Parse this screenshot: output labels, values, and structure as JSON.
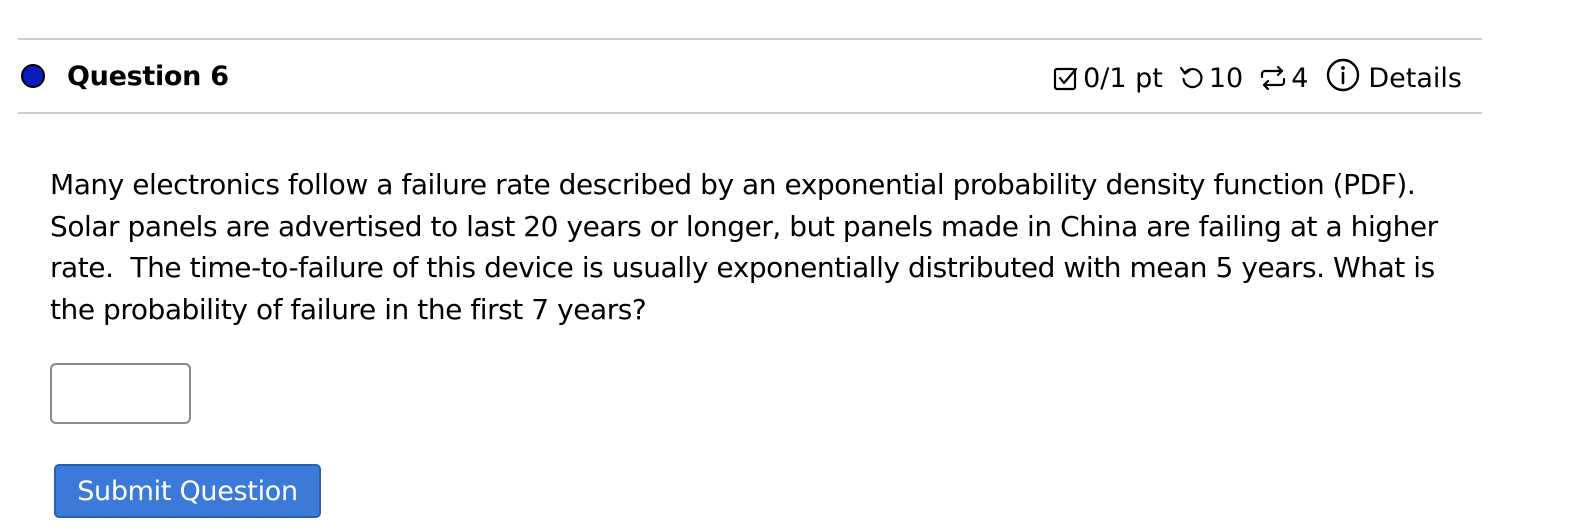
{
  "question": {
    "title": "Question 6",
    "status_color": "#0a1cbd",
    "score": "0/1 pt",
    "attempts": "10",
    "versions": "4",
    "details_label": "Details",
    "icons": {
      "score": "checkbox-icon",
      "attempts": "retry-icon",
      "versions": "swap-icon",
      "details": "info-icon"
    },
    "text": "Many electronics follow a failure rate described by an exponential probability density function (PDF).  Solar panels are advertised to last 20 years or longer, but panels made in China are failing at a higher rate.  The time-to-failure of this device is usually exponentially distributed with mean 5 years. What is the probability of failure in the first 7 years?",
    "answer_value": "",
    "submit_label": "Submit Question",
    "submit_color": "#3b7ad8"
  }
}
